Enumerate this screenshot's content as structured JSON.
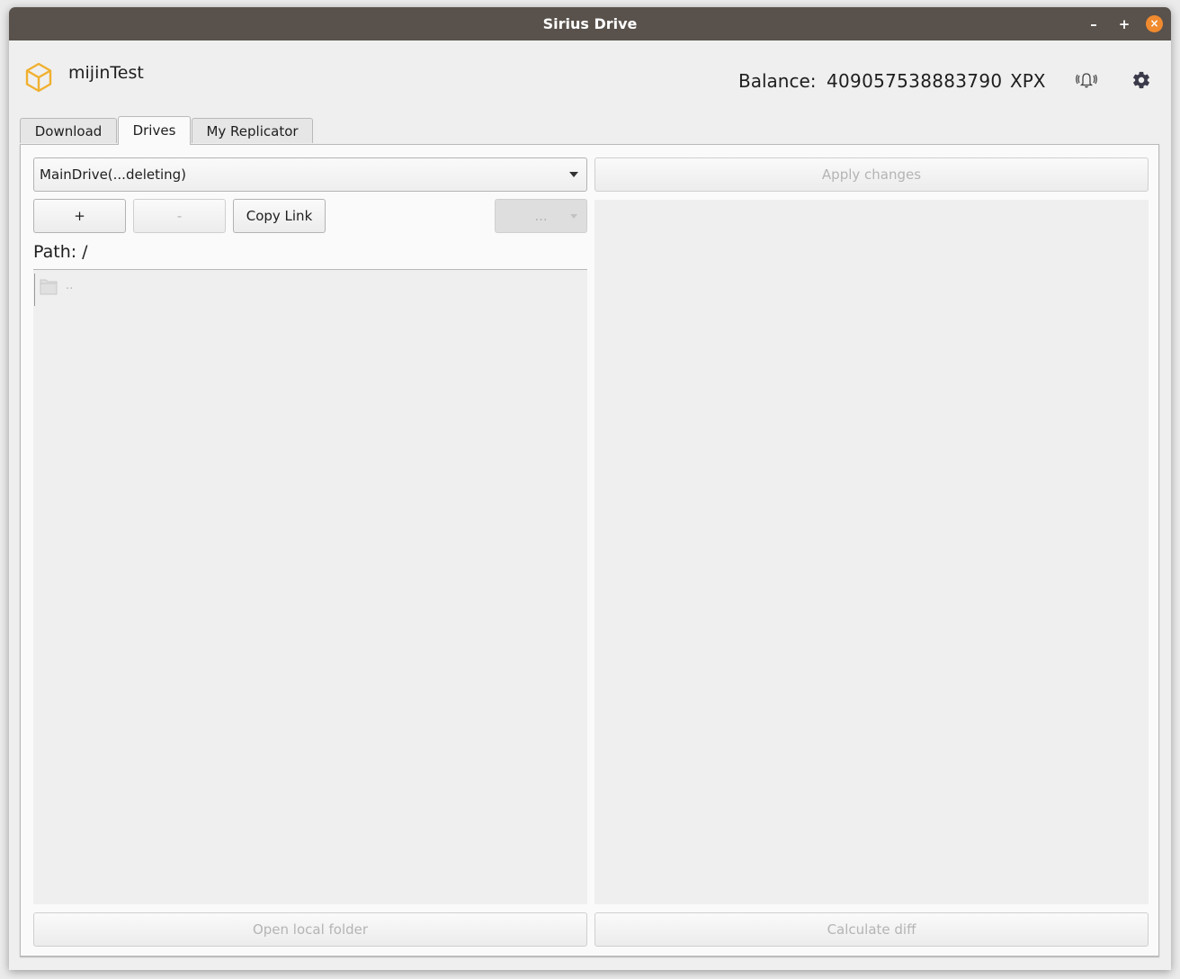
{
  "window": {
    "title": "Sirius Drive",
    "controls": {
      "minimize": "–",
      "maximize": "+",
      "close": "×"
    }
  },
  "header": {
    "account_name": "mijinTest",
    "balance_label": "Balance:",
    "balance_value": "409057538883790",
    "balance_unit": "XPX",
    "icons": [
      "box-logo-icon",
      "bell-ringing-icon",
      "gear-icon"
    ],
    "accent_color": "#f0b030"
  },
  "tabs": [
    {
      "label": "Download",
      "active": false
    },
    {
      "label": "Drives",
      "active": true
    },
    {
      "label": "My Replicator",
      "active": false
    }
  ],
  "drives": {
    "selected_drive": "MainDrive(...deleting)",
    "apply_changes_label": "Apply changes",
    "add_label": "+",
    "remove_label": "-",
    "copy_link_label": "Copy Link",
    "more_label": "...",
    "path_label": "Path: /",
    "files": [
      {
        "name": "..",
        "type": "folder"
      }
    ],
    "open_local_folder_label": "Open local folder",
    "calculate_diff_label": "Calculate diff"
  }
}
